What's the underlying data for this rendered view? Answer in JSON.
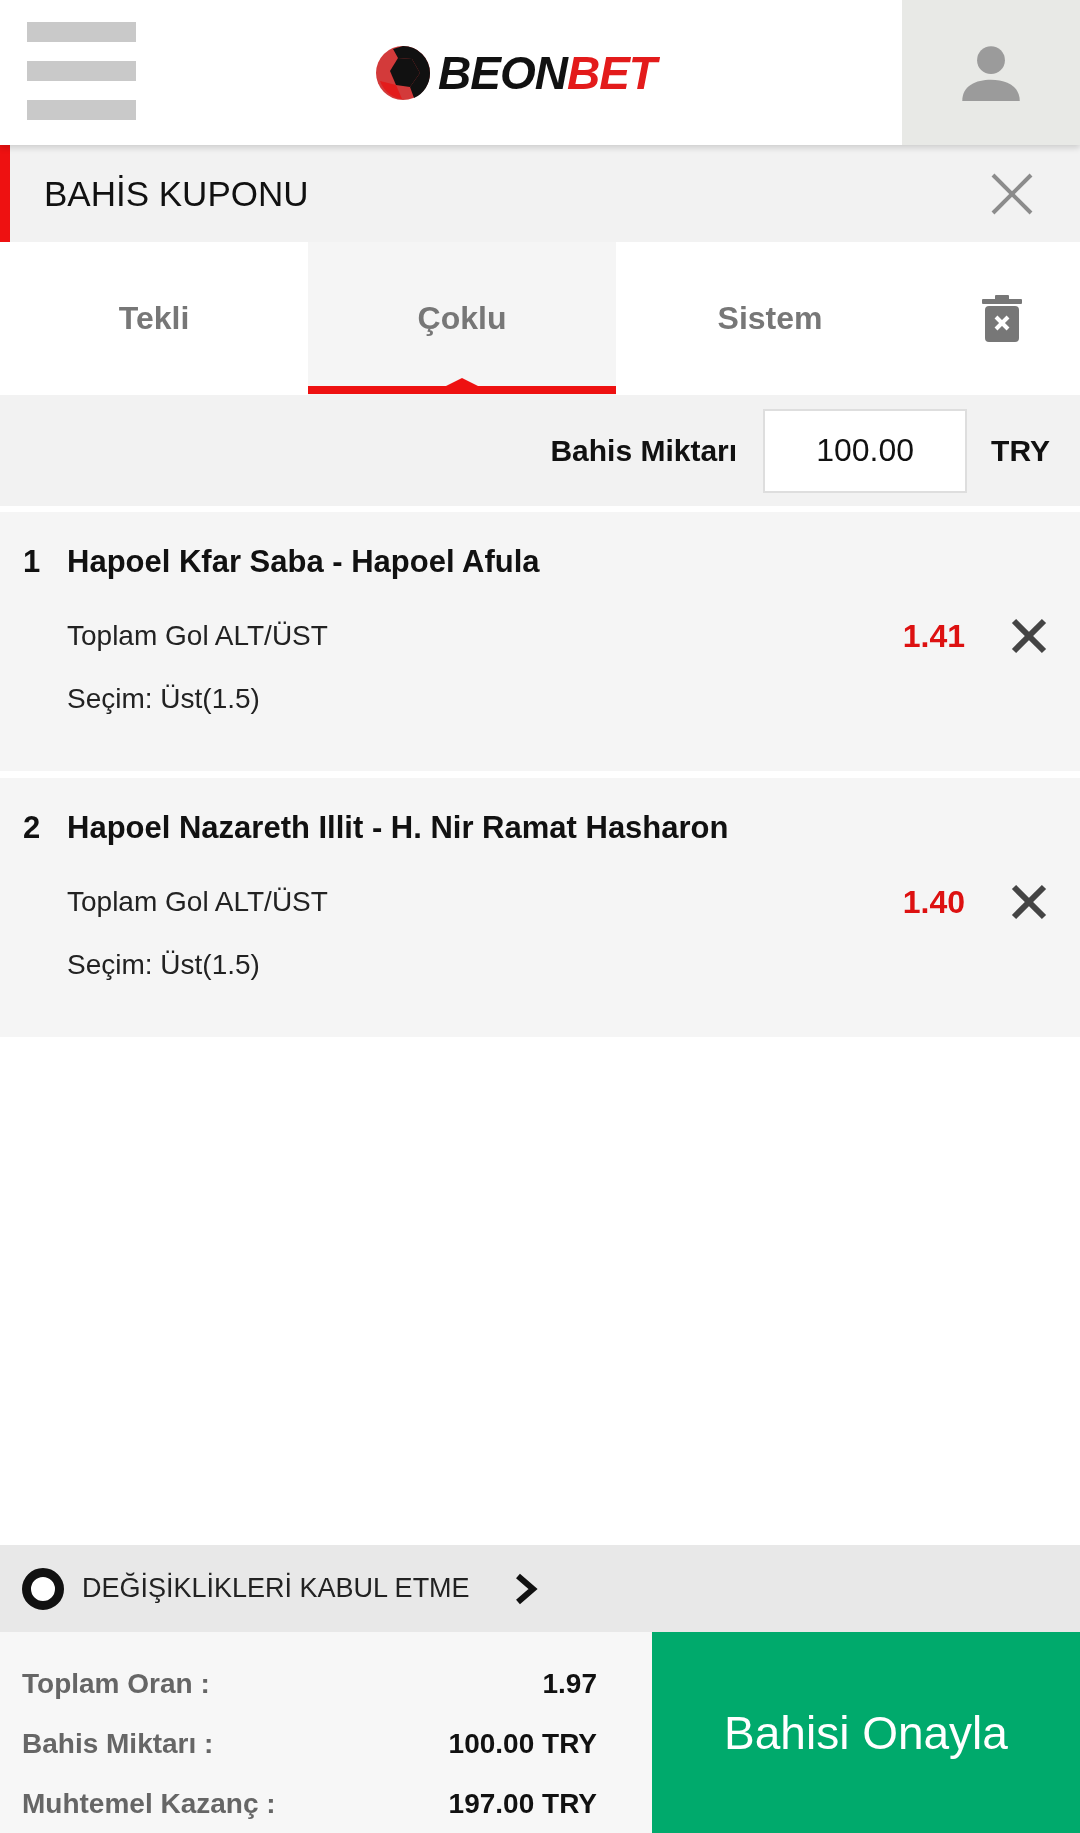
{
  "header": {
    "logo": {
      "parts": [
        {
          "text": "BEON",
          "color": "#111111"
        },
        {
          "text": "BET",
          "color": "#e31b1b"
        }
      ]
    }
  },
  "coupon": {
    "title": "BAHİS KUPONU"
  },
  "tabs": [
    {
      "label": "Tekli",
      "selected": false
    },
    {
      "label": "Çoklu",
      "selected": true
    },
    {
      "label": "Sistem",
      "selected": false
    }
  ],
  "stake": {
    "label": "Bahis Miktarı",
    "value": "100.00",
    "currency": "TRY"
  },
  "bets": [
    {
      "number": "1",
      "match": "Hapoel Kfar Saba - Hapoel Afula",
      "market": "Toplam Gol ALT/ÜST",
      "odds": "1.41",
      "selection": "Seçim: Üst(1.5)"
    },
    {
      "number": "2",
      "match": "Hapoel Nazareth Illit - H. Nir Ramat Hasharon",
      "market": "Toplam Gol ALT/ÜST",
      "odds": "1.40",
      "selection": "Seçim: Üst(1.5)"
    }
  ],
  "accept_changes": {
    "label": "DEĞİŞİKLİKLERİ KABUL ETME"
  },
  "summary": {
    "rows": [
      {
        "label": "Toplam Oran :",
        "value": "1.97"
      },
      {
        "label": "Bahis Miktarı :",
        "value": "100.00 TRY"
      },
      {
        "label": "Muhtemel Kazanç :",
        "value": "197.00 TRY"
      }
    ]
  },
  "confirm_button": {
    "label": "Bahisi Onayla"
  }
}
